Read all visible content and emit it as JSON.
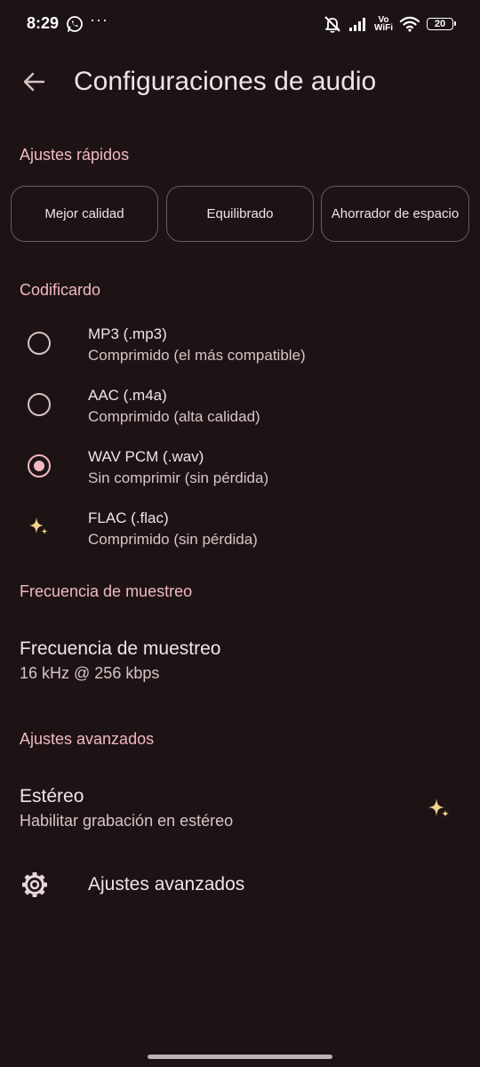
{
  "status_bar": {
    "time": "8:29",
    "more_indicator": "···",
    "volte_top": "Vo",
    "volte_bottom": "WiFi",
    "battery": "20"
  },
  "app_bar": {
    "title": "Configuraciones de audio"
  },
  "quick_settings": {
    "header": "Ajustes rápidos",
    "chips": [
      "Mejor calidad",
      "Equilibrado",
      "Ahorrador de espacio"
    ]
  },
  "encoder": {
    "header": "Codificardo",
    "options": [
      {
        "title": "MP3 (.mp3)",
        "subtitle": "Comprimido (el más compatible)",
        "state": "unselected"
      },
      {
        "title": "AAC (.m4a)",
        "subtitle": "Comprimido (alta calidad)",
        "state": "unselected"
      },
      {
        "title": "WAV PCM (.wav)",
        "subtitle": "Sin comprimir (sin pérdida)",
        "state": "selected"
      },
      {
        "title": "FLAC (.flac)",
        "subtitle": "Comprimido (sin pérdida)",
        "state": "premium"
      }
    ]
  },
  "sample_rate": {
    "header": "Frecuencia de muestreo",
    "title": "Frecuencia de muestreo",
    "value": "16 kHz @ 256 kbps"
  },
  "advanced": {
    "header": "Ajustes avanzados",
    "stereo_title": "Estéreo",
    "stereo_subtitle": "Habilitar grabación en estéreo",
    "advanced_label": "Ajustes avanzados"
  },
  "colors": {
    "background": "#1d1315",
    "accent": "#f3b8c0",
    "sparkle": "#f4d28c",
    "text": "#f1e4e6"
  }
}
